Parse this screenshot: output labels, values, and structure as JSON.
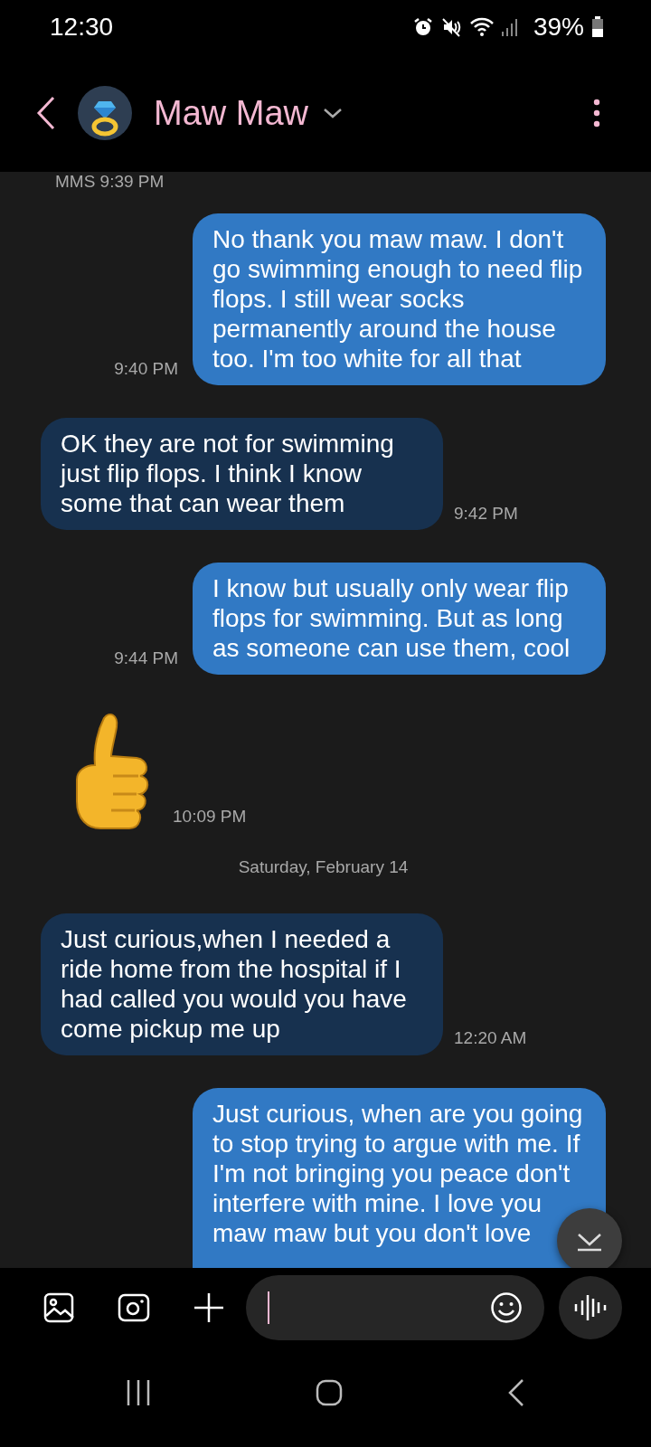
{
  "status_bar": {
    "time": "12:30",
    "battery": "39%"
  },
  "header": {
    "contact": "Maw Maw"
  },
  "messages": [
    {
      "kind": "label",
      "text": "MMS 9:39 PM"
    },
    {
      "kind": "sent",
      "text": "No thank you maw maw. I don't go swimming enough to need flip flops. I still wear socks permanently around the house too. I'm too white for all that",
      "time": "9:40 PM"
    },
    {
      "kind": "received",
      "text": "OK they are not for swimming just flip flops. I think I know some that can wear them",
      "time": "9:42 PM"
    },
    {
      "kind": "sent",
      "text": "I know but usually only wear flip flops for swimming. But as long as someone can use them, cool",
      "time": "9:44 PM"
    },
    {
      "kind": "sticker",
      "time": "10:09 PM"
    },
    {
      "kind": "date",
      "text": "Saturday, February 14"
    },
    {
      "kind": "received",
      "text": "Just curious,when I needed a ride home from the hospital if I had called you would you have come pickup me up",
      "time": "12:20 AM"
    },
    {
      "kind": "sent",
      "text": "Just curious, when are you going to stop trying to argue with me. If I'm not bringing you peace don't interfere with mine. I love you maw maw but you don't love"
    }
  ]
}
